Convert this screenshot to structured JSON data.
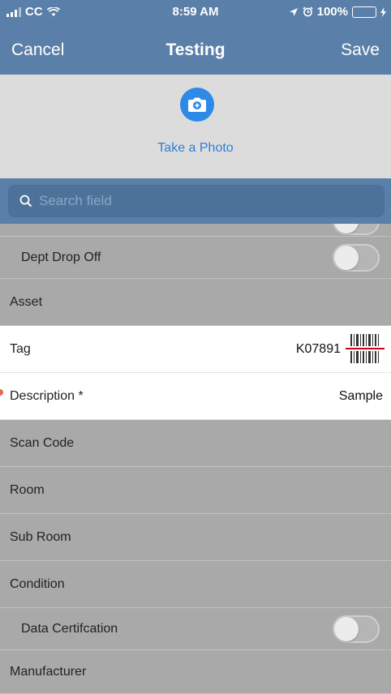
{
  "status_bar": {
    "carrier": "CC",
    "time": "8:59 AM",
    "battery": "100%",
    "icons": [
      "signal-icon",
      "wifi-icon",
      "location-icon",
      "alarm-icon",
      "battery-icon",
      "charging-icon"
    ]
  },
  "nav": {
    "cancel_label": "Cancel",
    "title": "Testing",
    "save_label": "Save"
  },
  "photo": {
    "label": "Take a Photo",
    "icon": "camera-plus-icon"
  },
  "search": {
    "placeholder": "Search field",
    "value": ""
  },
  "form": {
    "dept_drop_off": {
      "label": "Dept Drop Off",
      "on": false
    },
    "asset": {
      "label": "Asset"
    },
    "tag": {
      "label": "Tag",
      "value": "K07891",
      "icon": "barcode-scan-icon"
    },
    "description": {
      "label": "Description *",
      "value": "Sample"
    },
    "scan_code": {
      "label": "Scan Code"
    },
    "room": {
      "label": "Room"
    },
    "sub_room": {
      "label": "Sub Room"
    },
    "condition": {
      "label": "Condition"
    },
    "data_certification": {
      "label": "Data Certifcation",
      "on": false
    },
    "manufacturer": {
      "label": "Manufacturer"
    }
  },
  "colors": {
    "header": "#5a7fa8",
    "accent": "#2d8ae6",
    "disabled_row": "#a9a9a9",
    "active_row": "#ffffff"
  }
}
